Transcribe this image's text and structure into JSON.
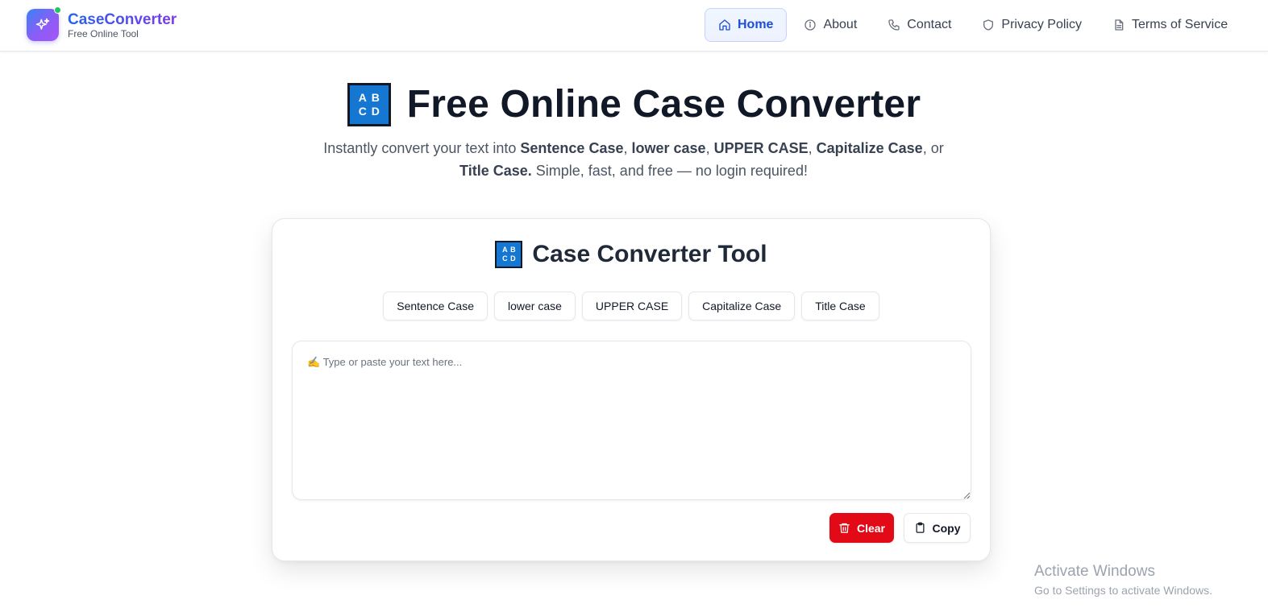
{
  "brand": {
    "name": "CaseConverter",
    "tagline": "Free Online Tool",
    "logo_icon": "sparkles-icon"
  },
  "nav": {
    "items": [
      {
        "label": "Home",
        "icon": "home-icon",
        "active": true
      },
      {
        "label": "About",
        "icon": "info-icon",
        "active": false
      },
      {
        "label": "Contact",
        "icon": "phone-icon",
        "active": false
      },
      {
        "label": "Privacy Policy",
        "icon": "shield-icon",
        "active": false
      },
      {
        "label": "Terms of Service",
        "icon": "document-icon",
        "active": false
      }
    ]
  },
  "hero": {
    "badge_letters": [
      "A",
      "B",
      "C",
      "D"
    ],
    "title": "Free Online Case Converter",
    "desc_intro": "Instantly convert your text into ",
    "desc_case_1": "Sentence Case",
    "desc_sep_1": ", ",
    "desc_case_2": "lower case",
    "desc_sep_2": ", ",
    "desc_case_3": "UPPER CASE",
    "desc_sep_3": ", ",
    "desc_case_4": "Capitalize Case",
    "desc_sep_4": ", or ",
    "desc_case_5": "Title Case.",
    "desc_outro": " Simple, fast, and free — no login required!"
  },
  "tool": {
    "title": "Case Converter Tool",
    "modes": [
      "Sentence Case",
      "lower case",
      "UPPER CASE",
      "Capitalize Case",
      "Title Case"
    ],
    "input_placeholder": "✍️ Type or paste your text here...",
    "input_value": "",
    "clear_label": "Clear",
    "copy_label": "Copy"
  },
  "watermark": {
    "line1": "Activate Windows",
    "line2": "Go to Settings to activate Windows."
  },
  "colors": {
    "brand_gradient_start": "#3b82f6",
    "brand_gradient_end": "#a855f7",
    "active_nav_text": "#1d4ed8",
    "clear_button": "#e20a16",
    "badge_blue": "#1677d2",
    "online_dot": "#22c55e"
  }
}
